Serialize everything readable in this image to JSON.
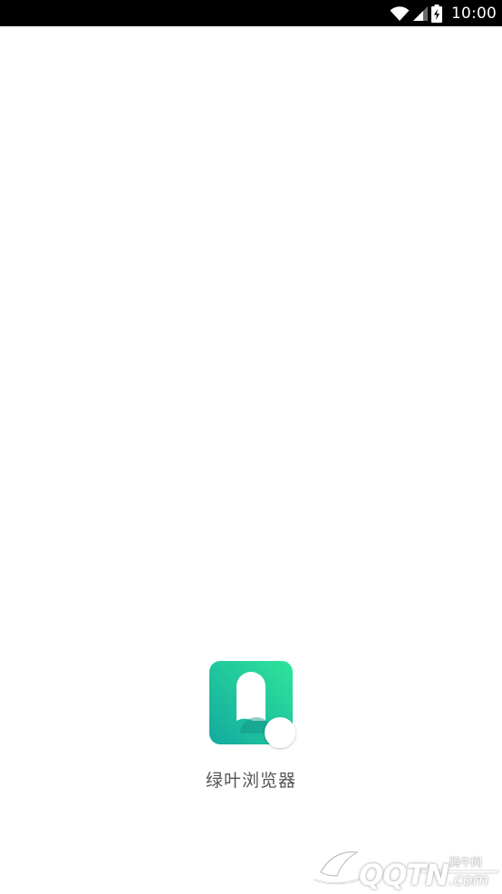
{
  "status_bar": {
    "time": "10:00",
    "icons": [
      "wifi-icon",
      "signal-icon",
      "battery-charging-icon"
    ]
  },
  "splash": {
    "app_name": "绿叶浏览器",
    "logo_icon": "green-leaf-browser-logo",
    "colors": {
      "logo_gradient_top": "#2ee59a",
      "logo_gradient_bottom": "#14a99f"
    }
  },
  "watermark": {
    "site_small": "腾牛网",
    "site_main": "QQTN",
    "site_suffix": ".com"
  }
}
